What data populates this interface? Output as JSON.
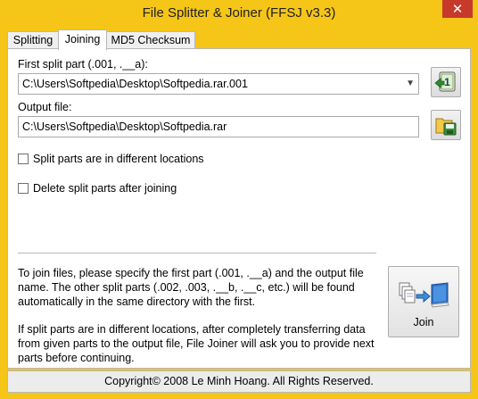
{
  "window": {
    "title": "File Splitter & Joiner (FFSJ v3.3)",
    "close_glyph": "✕",
    "accent_color": "#f5c518"
  },
  "tabs": [
    {
      "label": "Splitting",
      "active": false
    },
    {
      "label": "Joining",
      "active": true
    },
    {
      "label": "MD5 Checksum",
      "active": false
    }
  ],
  "first_part": {
    "label": "First split part (.001, .__a):",
    "value": "C:\\Users\\Softpedia\\Desktop\\Softpedia.rar.001",
    "button_icon": "open-first-part-icon"
  },
  "output": {
    "label": "Output file:",
    "value": "C:\\Users\\Softpedia\\Desktop\\Softpedia.rar",
    "button_icon": "save-output-icon"
  },
  "options": [
    {
      "label": "Split parts are in different locations",
      "checked": false
    },
    {
      "label": "Delete split parts after joining",
      "checked": false
    }
  ],
  "info": {
    "paragraph1": "To join files, please specify the first part (.001, .__a) and the output file name. The other split parts (.002, .003, .__b, .__c, etc.) will be found automatically in the same directory with the first.",
    "paragraph2": "If split parts are in different locations, after completely transferring data from given parts to the output file, File Joiner will ask you to provide next parts before continuing."
  },
  "join_button": {
    "label": "Join",
    "icon": "join-files-icon"
  },
  "footer": {
    "text": "Copyright© 2008 Le Minh Hoang. All Rights Reserved."
  }
}
